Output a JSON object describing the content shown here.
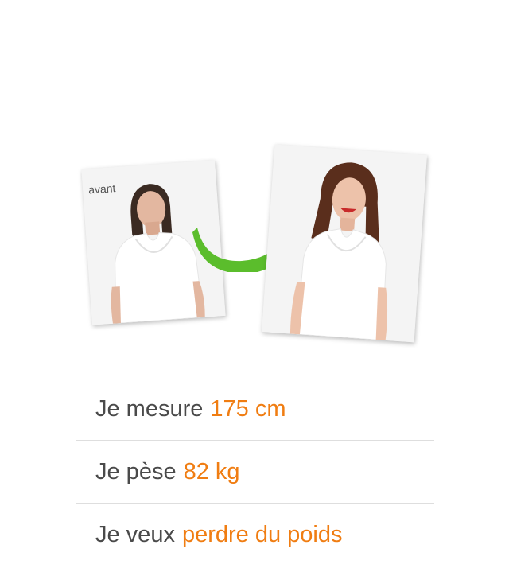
{
  "transformation": {
    "before_caption": "avant",
    "arrow_color": "#5bbd2c"
  },
  "profile": {
    "accent_color": "#f07d12",
    "rows": [
      {
        "label": "Je mesure",
        "value": "175 cm"
      },
      {
        "label": "Je pèse",
        "value": "82 kg"
      },
      {
        "label": "Je veux",
        "value": "perdre du poids"
      }
    ]
  }
}
